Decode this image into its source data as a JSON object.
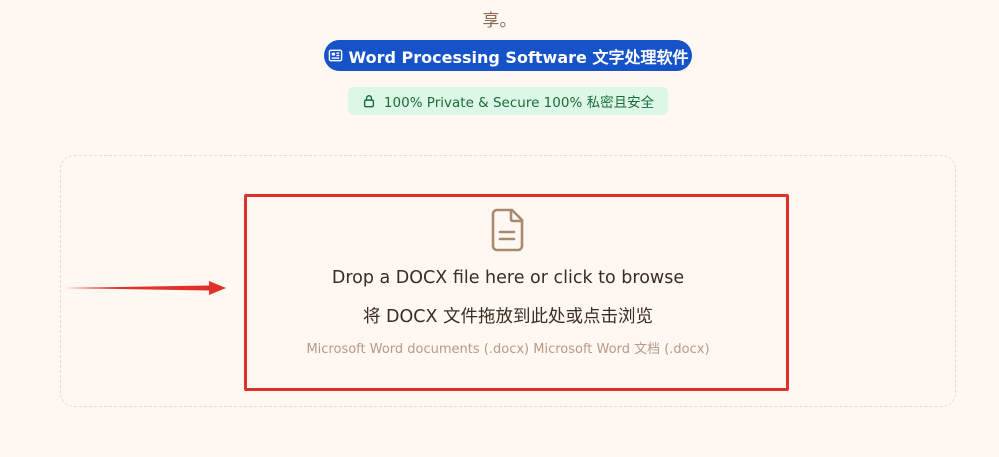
{
  "header": {
    "top_text": "享。"
  },
  "category_badge": {
    "label": "Word Processing Software 文字处理软件",
    "icon": "newspaper-icon",
    "color": "#1652c8"
  },
  "secure_badge": {
    "label": "100% Private & Secure  100% 私密且安全",
    "icon": "lock-icon",
    "color": "#ddf7e6"
  },
  "upload": {
    "icon": "file-text-icon",
    "title": "Drop a DOCX file here or click to browse",
    "title_cn": "将 DOCX 文件拖放到此处或点击浏览",
    "hint": "Microsoft Word documents (.docx) Microsoft Word 文档 (.docx)"
  },
  "annotation": {
    "highlight_color": "#e0302a",
    "arrow_icon": "arrow-right-icon"
  }
}
